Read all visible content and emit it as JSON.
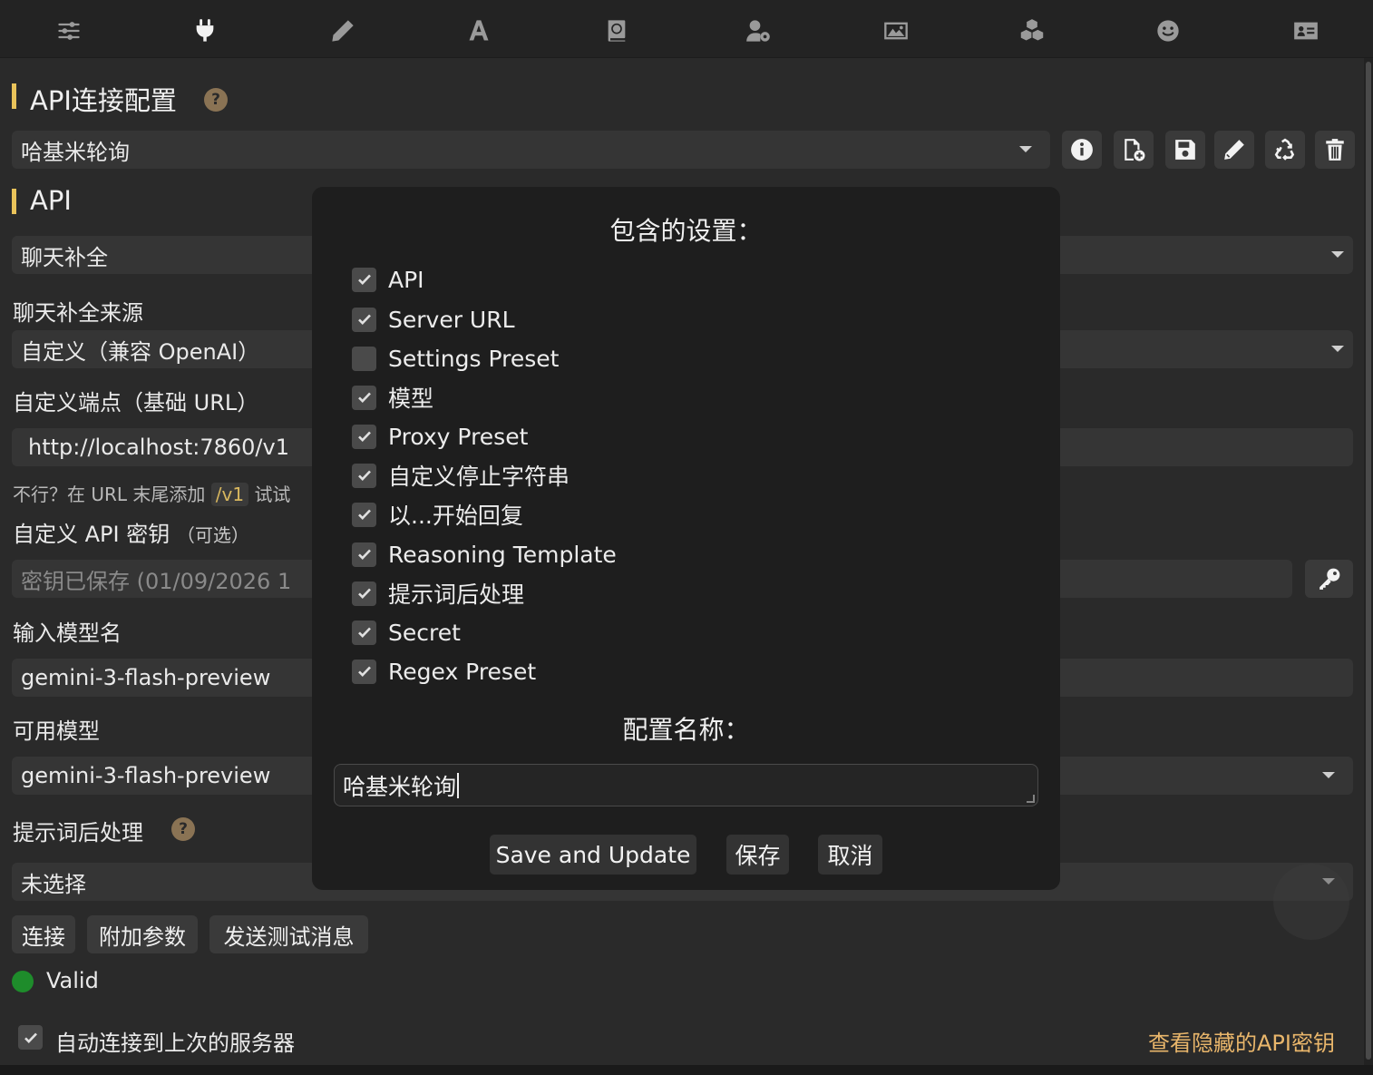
{
  "nav_tabs": [
    {
      "icon": "sliders-icon"
    },
    {
      "icon": "plug-icon"
    },
    {
      "icon": "pencil-icon"
    },
    {
      "icon": "font-icon"
    },
    {
      "icon": "book-atlas-icon"
    },
    {
      "icon": "user-gear-icon"
    },
    {
      "icon": "image-icon"
    },
    {
      "icon": "cubes-icon"
    },
    {
      "icon": "smile-icon"
    },
    {
      "icon": "id-card-icon"
    }
  ],
  "connection": {
    "heading": "API连接配置",
    "help": "?",
    "profile_value": "哈基米轮询"
  },
  "api": {
    "heading": "API",
    "api_value": "聊天补全",
    "source_label": "聊天补全来源",
    "source_value": "自定义（兼容 OpenAI）",
    "endpoint_label": "自定义端点（基础 URL）",
    "endpoint_value": "http://localhost:7860/v1",
    "hint_prefix": "不行？在 URL 末尾添加",
    "hint_code": "/v1",
    "hint_suffix": "试试",
    "key_label": "自定义 API 密钥",
    "key_optional": "（可选）",
    "key_placeholder": "密钥已保存 (01/09/2026 1",
    "model_input_label": "输入模型名",
    "model_input_value": "gemini-3-flash-preview",
    "available_label": "可用模型",
    "available_value": "gemini-3-flash-preview",
    "postproc_label": "提示词后处理",
    "postproc_help": "?",
    "postproc_value": "未选择"
  },
  "actions": {
    "connect": "连接",
    "extra_params": "附加参数",
    "send_test": "发送测试消息"
  },
  "status": {
    "text": "Valid",
    "color": "#1e8c2b"
  },
  "auto_connect": {
    "label": "自动连接到上次的服务器",
    "checked": true
  },
  "view_hidden_keys": "查看隐藏的API密钥",
  "modal": {
    "title": "包含的设置：",
    "options": [
      {
        "label": "API",
        "checked": true
      },
      {
        "label": "Server URL",
        "checked": true
      },
      {
        "label": "Settings Preset",
        "checked": false
      },
      {
        "label": "模型",
        "checked": true
      },
      {
        "label": "Proxy Preset",
        "checked": true
      },
      {
        "label": "自定义停止字符串",
        "checked": true
      },
      {
        "label": "以...开始回复",
        "checked": true
      },
      {
        "label": "Reasoning Template",
        "checked": true
      },
      {
        "label": "提示词后处理",
        "checked": true
      },
      {
        "label": "Secret",
        "checked": true
      },
      {
        "label": "Regex Preset",
        "checked": true
      }
    ],
    "name_title": "配置名称：",
    "name_value": "哈基米轮询",
    "buttons": {
      "save_update": "Save and Update",
      "save": "保存",
      "cancel": "取消"
    }
  },
  "colors": {
    "accent": "#e9c35a",
    "link": "#e9b66b",
    "background": "#2a2a2a",
    "modal": "#1e1e1e"
  }
}
